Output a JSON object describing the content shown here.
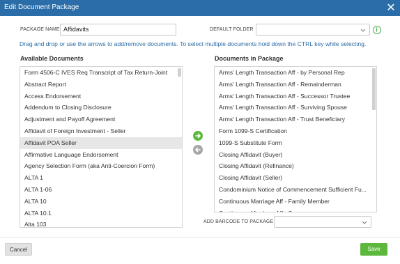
{
  "dialog": {
    "title": "Edit Document Package",
    "close_icon": "close-icon"
  },
  "form": {
    "package_name_label": "PACKAGE NAME",
    "package_name_value": "Affidavits",
    "default_folder_label": "DEFAULT FOLDER",
    "default_folder_value": "",
    "instructions": "Drag and drop or use the arrows to add/remove documents. To select multiple documents hold down the CTRL key while selecting."
  },
  "available": {
    "header": "Available Documents",
    "items": [
      "Form 4506-C IVES Req Transcript of Tax Return-Joint",
      "Abstract Report",
      "Access Endorsement",
      "Addendum to Closing Disclosure",
      "Adjustment and Payoff Agreement",
      "Affidavit of Foreign Investment - Seller",
      "Affidavit POA Seller",
      "Affirmative Language Endorsement",
      "Agency Selection Form (aka Anti-Coercion Form)",
      "ALTA 1",
      "ALTA 1-06",
      "ALTA 10",
      "ALTA 10.1",
      "Alta 103"
    ],
    "selected_index": 6
  },
  "package": {
    "header": "Documents in Package",
    "items": [
      "Arms' Length Transaction Aff - by Personal Rep",
      "Arms' Length Transaction Aff - Remainderman",
      "Arms' Length Transaction Aff - Successor Trustee",
      "Arms' Length Transaction Aff - Surviving Spouse",
      "Arms' Length Transaction Aff - Trust Beneficiary",
      "Form 1099-S Certification",
      "1099-S Substitute Form",
      "Closing Affidavit (Buyer)",
      "Closing Affidavit (Refinance)",
      "Closing Affidavit (Seller)",
      "Condominium Notice of Commencement Sufficient Fu...",
      "Continuous Marriage Aff - Family Member",
      "Continuous Marriage Aff - Spouse"
    ]
  },
  "barcode": {
    "label": "ADD BARCODE TO PACKAGE",
    "value": ""
  },
  "buttons": {
    "cancel": "Cancel",
    "save": "Save"
  },
  "colors": {
    "titlebar": "#2b6da8",
    "accent_green": "#5cb83c",
    "arrow_gray": "#a6a6a6"
  }
}
